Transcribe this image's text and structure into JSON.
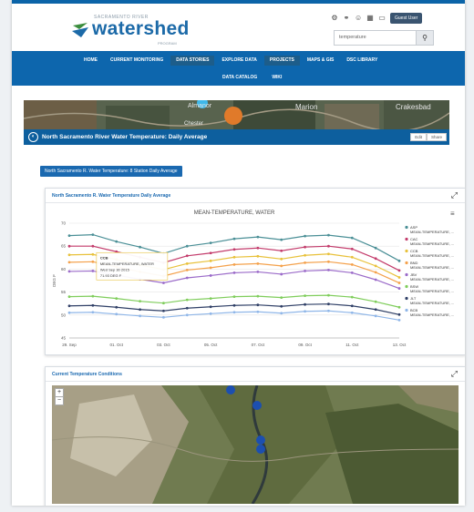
{
  "header": {
    "logo_small": "SACRAMENTO RIVER",
    "logo_big": "watershed",
    "logo_sub": "PROGRAM",
    "login_label": "Guest User",
    "search_value": "temperature"
  },
  "nav": {
    "row1": [
      "HOME",
      "CURRENT MONITORING",
      "DATA STORIES",
      "EXPLORE DATA",
      "PROJECTS",
      "MAPS & GIS",
      "DSC LIBRARY"
    ],
    "row2": [
      "DATA CATALOG",
      "WIKI"
    ],
    "highlighted": [
      "DATA STORIES",
      "PROJECTS"
    ]
  },
  "hero_map": {
    "labels": [
      "Marion",
      "Crakesbad",
      "Almanor",
      "Chester"
    ]
  },
  "page": {
    "title": "North Sacramento River Water Temperature: Daily Average",
    "title_buttons": [
      "Edit",
      "Share"
    ],
    "tab_button": "North Sacramento R. Water Temperature: 8 Station Daily Average"
  },
  "chart_panel": {
    "header": "North Sacramento R. Water Temperature Daily Average",
    "menu_icon": "hamburger-icon",
    "expand_icon": "expand-icon"
  },
  "map_panel": {
    "header": "Current Temperature Conditions",
    "zoom_in": "+",
    "zoom_out": "−"
  },
  "chart_data": {
    "type": "line",
    "title": "MEAN-TEMPERATURE, WATER",
    "ylabel": "DEG F",
    "ylim": [
      45,
      70
    ],
    "yticks": [
      45,
      50,
      55,
      60,
      65,
      70
    ],
    "categories": [
      "29. Sep",
      "30. Sep",
      "01. Oct",
      "02. Oct",
      "03. Oct",
      "04. Oct",
      "05. Oct",
      "06. Oct",
      "07. Oct",
      "08. Oct",
      "09. Oct",
      "10. Oct",
      "11. Oct",
      "12. Oct",
      "13. Oct"
    ],
    "x_tick_labels": [
      "29. Sep",
      "01. Oct",
      "03. Oct",
      "05. Oct",
      "07. Oct",
      "09. Oct",
      "11. Oct",
      "13. Oct"
    ],
    "series": [
      {
        "name": "ASP",
        "color": "#4a8f96",
        "values": [
          67.3,
          67.5,
          66.0,
          64.8,
          63.4,
          65.0,
          65.7,
          66.6,
          67.0,
          66.4,
          67.2,
          67.4,
          66.8,
          64.6,
          61.8
        ]
      },
      {
        "name": "CAC",
        "color": "#c33b6b",
        "values": [
          65.0,
          65.0,
          63.8,
          62.6,
          61.4,
          62.9,
          63.5,
          64.3,
          64.6,
          64.0,
          64.8,
          65.0,
          64.4,
          62.3,
          59.7
        ]
      },
      {
        "name": "CCB",
        "color": "#e8c13a",
        "values": [
          63.1,
          63.2,
          62.1,
          60.9,
          59.9,
          61.2,
          61.8,
          62.6,
          62.8,
          62.2,
          63.0,
          63.3,
          62.6,
          60.7,
          58.2
        ]
      },
      {
        "name": "BND",
        "color": "#f4a14b",
        "values": [
          61.5,
          61.6,
          60.5,
          59.4,
          58.5,
          59.8,
          60.3,
          61.0,
          61.2,
          60.7,
          61.4,
          61.6,
          61.0,
          59.3,
          57.0
        ]
      },
      {
        "name": "JBV",
        "color": "#9b6bc9",
        "values": [
          59.5,
          59.6,
          58.7,
          57.8,
          57.0,
          58.1,
          58.6,
          59.2,
          59.4,
          58.9,
          59.6,
          59.8,
          59.2,
          57.7,
          55.8
        ]
      },
      {
        "name": "BSW",
        "color": "#7fcd5b",
        "values": [
          54.0,
          54.1,
          53.6,
          53.0,
          52.6,
          53.3,
          53.6,
          54.0,
          54.1,
          53.8,
          54.2,
          54.3,
          53.9,
          52.9,
          51.7
        ]
      },
      {
        "name": "JLT",
        "color": "#2f3f66",
        "values": [
          52.0,
          52.1,
          51.7,
          51.2,
          50.9,
          51.5,
          51.8,
          52.1,
          52.2,
          51.9,
          52.3,
          52.4,
          52.0,
          51.2,
          50.1
        ]
      },
      {
        "name": "BCB",
        "color": "#8fb6e8",
        "values": [
          50.5,
          50.6,
          50.2,
          49.8,
          49.5,
          50.0,
          50.3,
          50.6,
          50.7,
          50.4,
          50.8,
          50.9,
          50.5,
          49.8,
          48.9
        ]
      }
    ],
    "legend_suffix": "MEAN-TEMPERATURE, ...",
    "legend_position": "right",
    "tooltip": {
      "series": "CCB",
      "lines": [
        "CCB",
        "MEAN-TEMPERATURE, WATER",
        "Wed Sep 30 2015",
        "71.93 DEG F"
      ]
    }
  }
}
